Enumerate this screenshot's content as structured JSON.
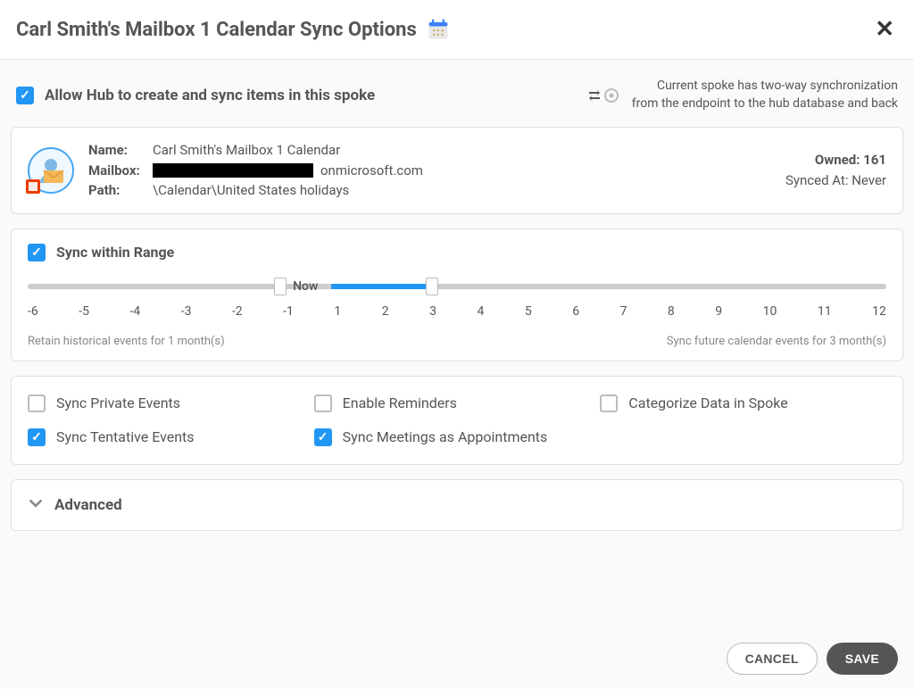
{
  "header": {
    "title": "Carl Smith's Mailbox 1 Calendar Sync Options"
  },
  "allow_hub": {
    "checked": true,
    "label": "Allow Hub to create and sync items in this spoke"
  },
  "sync_mode": {
    "line1": "Current spoke has two-way synchronization",
    "line2": "from the endpoint to the hub database and back"
  },
  "info": {
    "name_label": "Name:",
    "name_value": "Carl Smith's Mailbox 1 Calendar",
    "mailbox_label": "Mailbox:",
    "mailbox_suffix": "onmicrosoft.com",
    "path_label": "Path:",
    "path_value": "\\Calendar\\United States holidays",
    "owned_label": "Owned:",
    "owned_value": "161",
    "synced_label": "Synced At:",
    "synced_value": "Never"
  },
  "range": {
    "checked": true,
    "label": "Sync within Range",
    "now_label": "Now",
    "ticks": [
      "-6",
      "-5",
      "-4",
      "-3",
      "-2",
      "-1",
      "1",
      "2",
      "3",
      "4",
      "5",
      "6",
      "7",
      "8",
      "9",
      "10",
      "11",
      "12"
    ],
    "left_caption": "Retain historical events for 1 month(s)",
    "right_caption": "Sync future calendar events for 3 month(s)",
    "handle_left_index": 5,
    "handle_right_index": 8,
    "now_index": 6
  },
  "options": {
    "sync_private": {
      "checked": false,
      "label": "Sync Private Events"
    },
    "enable_reminders": {
      "checked": false,
      "label": "Enable Reminders"
    },
    "categorize": {
      "checked": false,
      "label": "Categorize Data in Spoke"
    },
    "sync_tentative": {
      "checked": true,
      "label": "Sync Tentative Events"
    },
    "sync_meetings": {
      "checked": true,
      "label": "Sync Meetings as Appointments"
    }
  },
  "advanced": {
    "label": "Advanced"
  },
  "footer": {
    "cancel": "CANCEL",
    "save": "SAVE"
  }
}
